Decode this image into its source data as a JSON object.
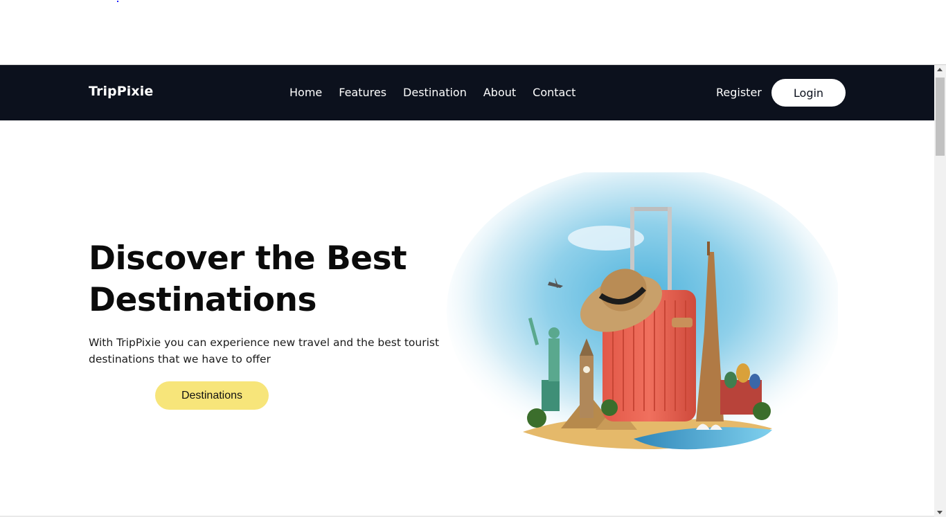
{
  "nav": {
    "brand": "TripPixie",
    "links": [
      "Home",
      "Features",
      "Destination",
      "About",
      "Contact"
    ],
    "register": "Register",
    "login": "Login",
    "bg_color": "#0c111d"
  },
  "hero": {
    "title_line1": "Discover the Best",
    "title_line2": "Destinations",
    "subtitle": "With TripPixie you can experience new travel and the best tourist destinations that we have to offer",
    "cta": "Destinations",
    "cta_color": "#f7e57a"
  },
  "icons": {
    "illustration": "travel-suitcase-landmarks-illustration",
    "scroll_up": "chevron-up-icon",
    "scroll_down": "chevron-down-icon"
  }
}
